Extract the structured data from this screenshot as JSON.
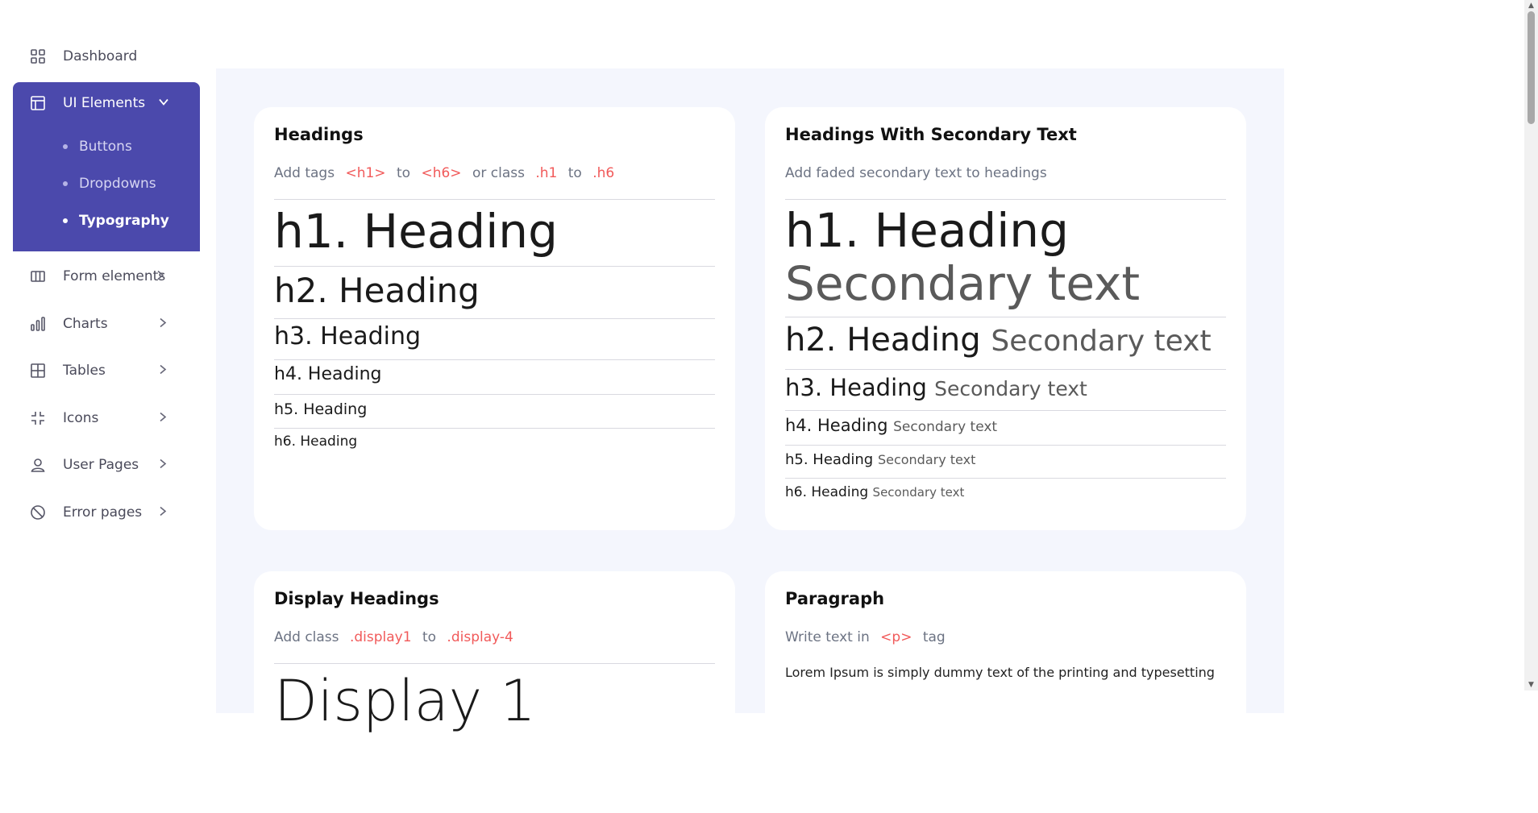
{
  "sidebar": {
    "dashboard": "Dashboard",
    "ui_elements": "UI Elements",
    "sub": [
      "Buttons",
      "Dropdowns",
      "Typography"
    ],
    "items": [
      "Form elements",
      "Charts",
      "Tables",
      "Icons",
      "User Pages",
      "Error pages"
    ]
  },
  "headings_card": {
    "title": "Headings",
    "desc_prefix": "Add tags",
    "tag1": "<h1>",
    "to1": "to",
    "tag2": "<h6>",
    "or_class": "or class",
    "cls1": ".h1",
    "to2": "to",
    "cls2": ".h6",
    "h1": "h1. Heading",
    "h2": "h2. Heading",
    "h3": "h3. Heading",
    "h4": "h4. Heading",
    "h5": "h5. Heading",
    "h6": "h6. Heading"
  },
  "secondary_card": {
    "title": "Headings With Secondary Text",
    "desc": "Add faded secondary text to headings",
    "h1": "h1. Heading",
    "h2": "h2. Heading",
    "h3": "h3. Heading",
    "h4": "h4. Heading",
    "h5": "h5. Heading",
    "h6": "h6. Heading",
    "secondary": "Secondary text"
  },
  "display_card": {
    "title": "Display Headings",
    "desc_prefix": "Add class",
    "cls1": ".display1",
    "to": "to",
    "cls2": ".display-4",
    "display1": "Display 1"
  },
  "paragraph_card": {
    "title": "Paragraph",
    "desc_prefix": "Write text in",
    "tag": "<p>",
    "desc_suffix": "tag",
    "text": "Lorem Ipsum is simply dummy text of the printing and typesetting"
  },
  "colors": {
    "accent": "#4b49ac",
    "code": "#f15a5a",
    "main_bg": "#f4f6fd"
  }
}
